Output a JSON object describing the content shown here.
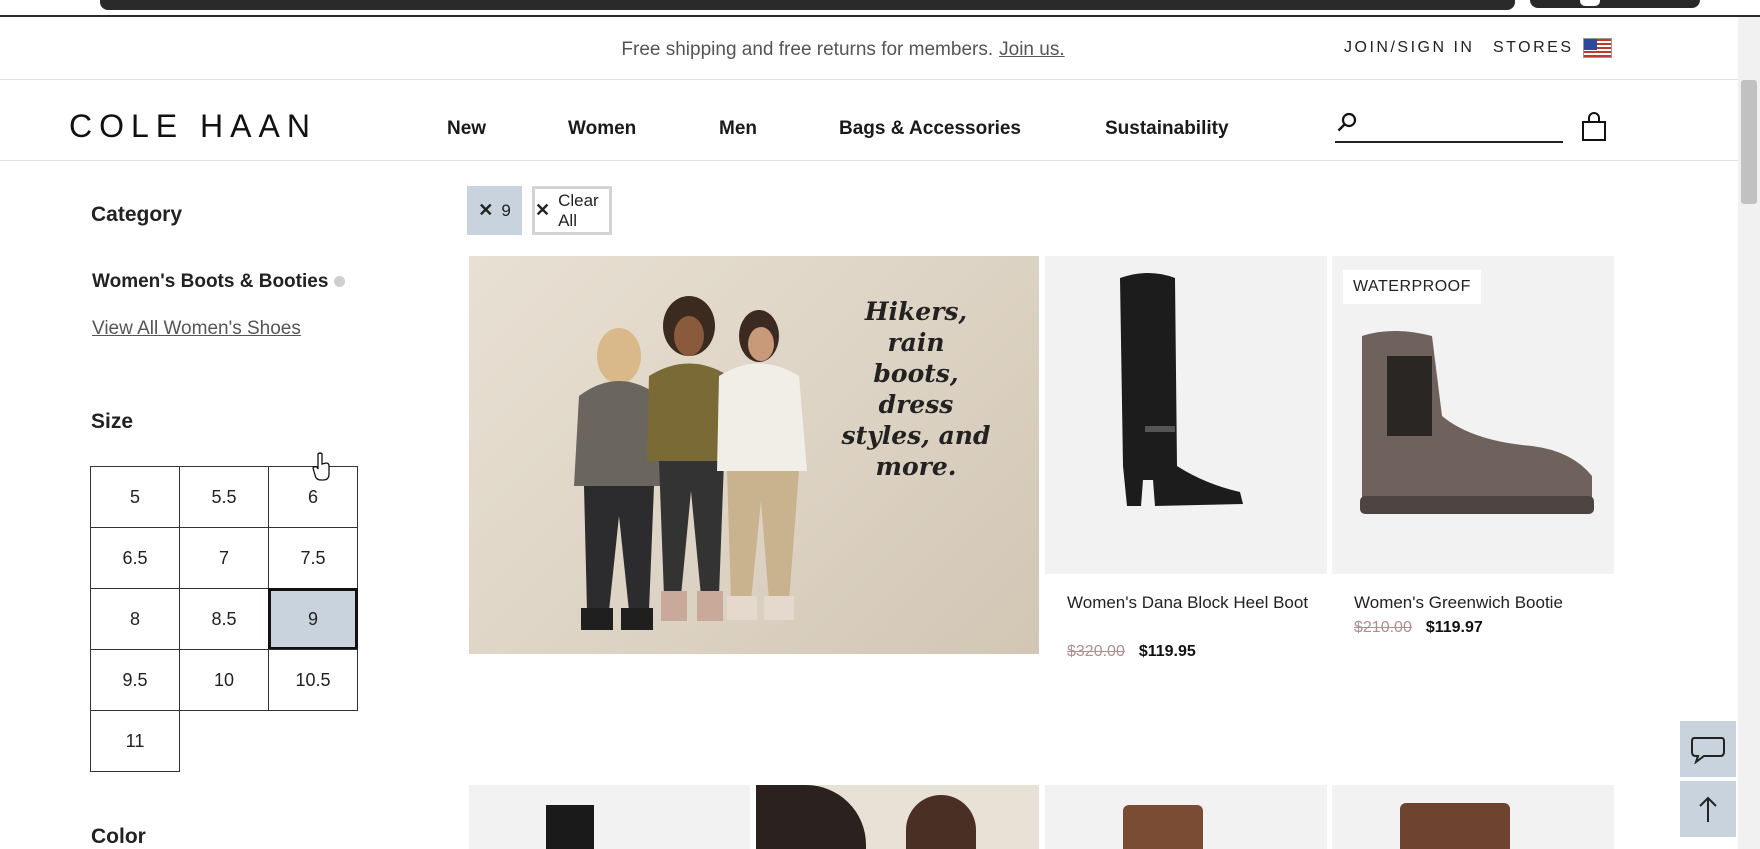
{
  "promo_bar": {
    "message": "Free shipping and free returns for members.",
    "join_link": "Join us.",
    "join_signin": "JOIN/SIGN IN",
    "stores": "STORES"
  },
  "header": {
    "logo": "COLE HAAN",
    "nav": [
      "New",
      "Women",
      "Men",
      "Bags & Accessories",
      "Sustainability"
    ],
    "search_value": ""
  },
  "filters": {
    "category_heading": "Category",
    "category_selected": "Women's Boots & Booties",
    "category_link": "View All Women's Shoes",
    "size_heading": "Size",
    "sizes": [
      "5",
      "5.5",
      "6",
      "6.5",
      "7",
      "7.5",
      "8",
      "8.5",
      "9",
      "9.5",
      "10",
      "10.5",
      "11"
    ],
    "selected_size": "9",
    "color_heading": "Color"
  },
  "active_filters": {
    "chip_label": "9",
    "clear_all": "Clear All"
  },
  "promo_tile": {
    "tagline": "Hikers, rain boots, dress styles, and more."
  },
  "products": [
    {
      "name": "Women's Dana Block Heel Boot",
      "original_price": "$320.00",
      "sale_price": "$119.95",
      "badge": ""
    },
    {
      "name": "Women's Greenwich Bootie",
      "original_price": "$210.00",
      "sale_price": "$119.97",
      "badge": "WATERPROOF"
    }
  ],
  "colors": {
    "selected_fill": "#c9d3dd",
    "strike_price": "#b08f8f"
  }
}
